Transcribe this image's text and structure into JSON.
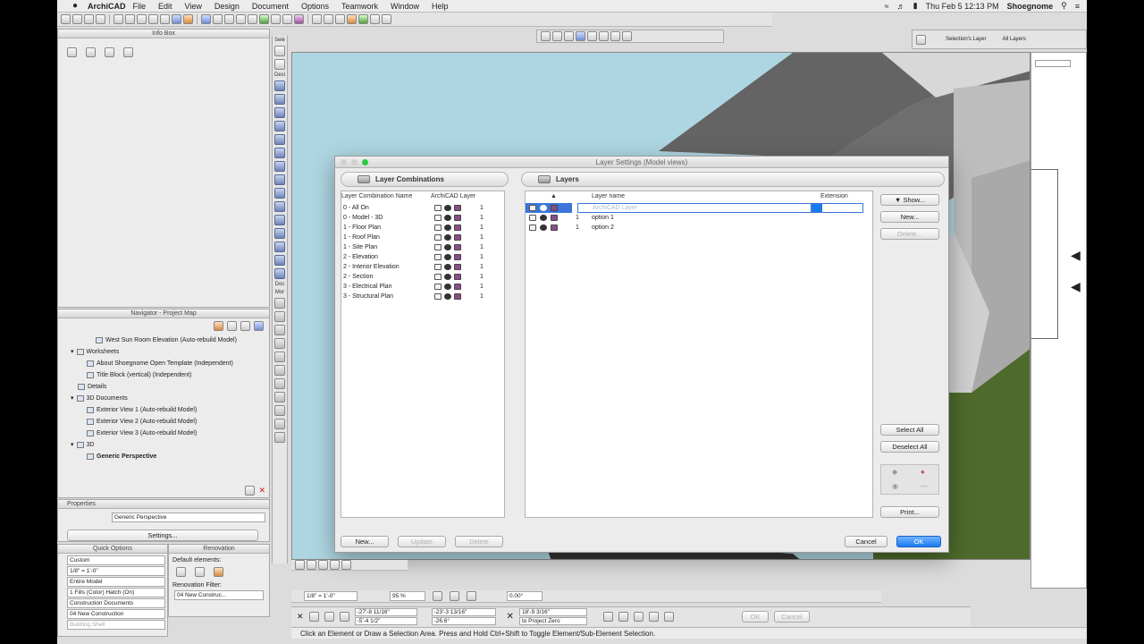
{
  "menubar": {
    "app": "ArchiCAD",
    "menus": [
      "File",
      "Edit",
      "View",
      "Design",
      "Document",
      "Options",
      "Teamwork",
      "Window",
      "Help"
    ],
    "clock": "Thu Feb 5  12:13 PM",
    "user": "Shoegnome"
  },
  "toolbar_right": {
    "selection_layer": "Selection's Layer",
    "all_layers": "All Layers"
  },
  "info_box": {
    "title": "Info Box"
  },
  "toolbox": {
    "select_label": "Sele",
    "design_label": "Desi",
    "document_label": "Doc",
    "more_label": "Mor"
  },
  "navigator": {
    "title": "Navigator - Project Map",
    "items": [
      "West Sun Room Elevation (Auto-rebuild Model)",
      "Worksheets",
      "About Shoegnome Open Template (Independent)",
      "Title Block (vertical) (Independent)",
      "Details",
      "3D Documents",
      "Exterior View 1 (Auto-rebuild Model)",
      "Exterior View 2 (Auto-rebuild Model)",
      "Exterior View 3 (Auto-rebuild Model)",
      "3D",
      "Generic Perspective"
    ]
  },
  "properties": {
    "title": "Properties",
    "value": "Generic Perspective",
    "settings_button": "Settings..."
  },
  "quick_options": {
    "title": "Quick Options",
    "items": [
      "Custom",
      "1/8\"  =  1'-0\"",
      "Entire Model",
      "1 Fills (Color) Hatch (On)",
      "Construction Documents",
      "04 New Construction",
      "Building Shell"
    ]
  },
  "renovation": {
    "title": "Renovation",
    "default_elements": "Default elements:",
    "filter_label": "Renovation Filter:",
    "filter_value": "04 New Construc..."
  },
  "dialog": {
    "title": "Layer Settings (Model views)",
    "combos_header": "Layer Combinations",
    "layers_header": "Layers",
    "combo_col_name": "Layer Combination Name",
    "combo_col_layer": "ArchiCAD Layer",
    "combinations": [
      {
        "name": "0 - All On",
        "num": "1"
      },
      {
        "name": "0 - Model - 3D",
        "num": "1"
      },
      {
        "name": "1 - Floor Plan",
        "num": "1"
      },
      {
        "name": "1 - Roof Plan",
        "num": "1"
      },
      {
        "name": "1 - Site Plan",
        "num": "1"
      },
      {
        "name": "2 - Elevation",
        "num": "1"
      },
      {
        "name": "2 - Interior Elevation",
        "num": "1"
      },
      {
        "name": "2 - Section",
        "num": "1"
      },
      {
        "name": "3 - Electrical Plan",
        "num": "1"
      },
      {
        "name": "3 - Structural Plan",
        "num": "1"
      }
    ],
    "layer_col_name": "Layer name",
    "layer_col_ext": "Extension",
    "layers": [
      {
        "num": "",
        "name": "ArchiCAD Layer",
        "selected": true
      },
      {
        "num": "1",
        "name": "option 1",
        "selected": false
      },
      {
        "num": "1",
        "name": "option 2",
        "selected": false
      }
    ],
    "show_button": "Show...",
    "new_layer_button": "New...",
    "delete_layer_button": "Delete...",
    "select_all_button": "Select All",
    "deselect_all_button": "Deselect All",
    "print_button": "Print...",
    "combo_new_button": "New...",
    "combo_update_button": "Update",
    "combo_delete_button": "Delete",
    "cancel_button": "Cancel",
    "ok_button": "OK"
  },
  "bottom": {
    "scale": "1/8\"  =  1'-0\"",
    "zoom": "95 %",
    "angle": "0.00°",
    "dx": "-27'-8 11/16\"",
    "dy": "-5'-4 1/2\"",
    "da": "-23'-3 13/16\"",
    "dr": "-26.6°",
    "dz": "18'-9 3/16\"",
    "to": "to Project Zero",
    "ok": "OK",
    "cancel": "Cancel",
    "status": "Click an Element or Draw a Selection Area. Press and Hold Ctrl+Shift to Toggle Element/Sub-Element Selection."
  },
  "colors": {
    "sky": "#aed6e2",
    "roof": "#646464",
    "wall": "#c9c9c9",
    "grass": "#4e6a2c",
    "accent": "#1a7bf0"
  }
}
